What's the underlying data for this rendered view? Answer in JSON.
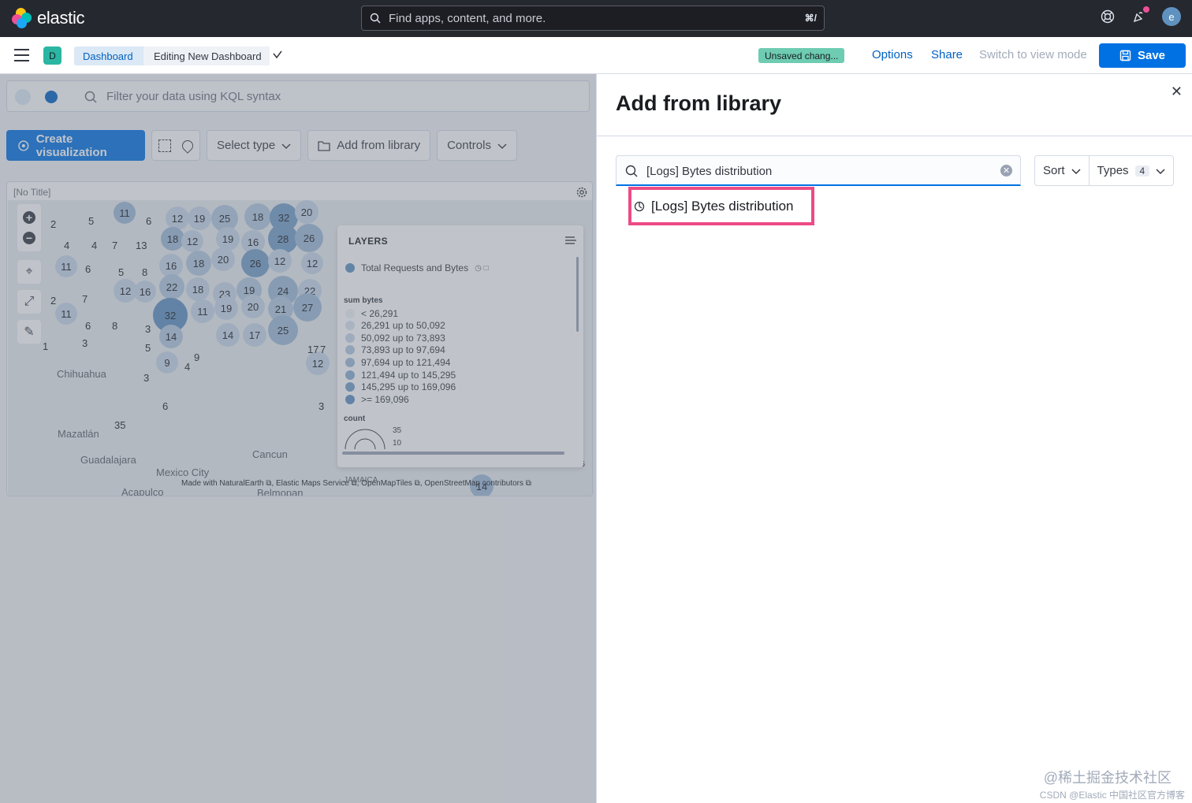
{
  "topbar": {
    "brand": "elastic",
    "search_placeholder": "Find apps, content, and more.",
    "search_shortcut": "⌘/",
    "avatar_initial": "e"
  },
  "header": {
    "space_initial": "D",
    "breadcrumbs": [
      "Dashboard",
      "Editing New Dashboard"
    ],
    "unsaved_badge": "Unsaved chang...",
    "options": "Options",
    "share": "Share",
    "switch_mode": "Switch to view mode",
    "save": "Save"
  },
  "query_bar": {
    "placeholder": "Filter your data using KQL syntax"
  },
  "toolbar": {
    "create_visualization": "Create visualization",
    "select_type": "Select type",
    "add_from_library": "Add from library",
    "controls": "Controls"
  },
  "panel": {
    "title": "[No Title]",
    "zoom": "zoom: 3.15",
    "attribution": "Made with NaturalEarth ⧉, Elastic Maps Service ⧉, OpenMapTiles ⧉, OpenStreetMap contributors ⧉",
    "cities": [
      "Chihuahua",
      "Mazatlán",
      "Guadalajara",
      "Mexico City",
      "Acapulco",
      "Cancun",
      "Belmopan",
      "JAMAICA"
    ]
  },
  "legend": {
    "title": "LAYERS",
    "layer_name": "Total Requests and Bytes",
    "sum_label": "sum bytes",
    "ranges": [
      "< 26,291",
      "26,291 up to 50,092",
      "50,092 up to 73,893",
      "73,893 up to 97,694",
      "97,694 up to 121,494",
      "121,494 up to 145,295",
      "145,295 up to 169,096",
      ">= 169,096"
    ],
    "range_colors": [
      "#ecf1f7",
      "#d9e3ef",
      "#c6d6e8",
      "#b2c8e0",
      "#9ebad8",
      "#89acd0",
      "#749ec8",
      "#5e90c0"
    ],
    "count_label": "count",
    "count_max": "35",
    "count_min": "10"
  },
  "flyout": {
    "title": "Add from library",
    "search_value": "[Logs] Bytes distribution",
    "sort": "Sort",
    "types": "Types",
    "types_count": "4",
    "result": "[Logs] Bytes distribution"
  },
  "watermark": {
    "line1": "@稀土掘金技术社区",
    "line2": "CSDN @Elastic 中国社区官方博客"
  }
}
